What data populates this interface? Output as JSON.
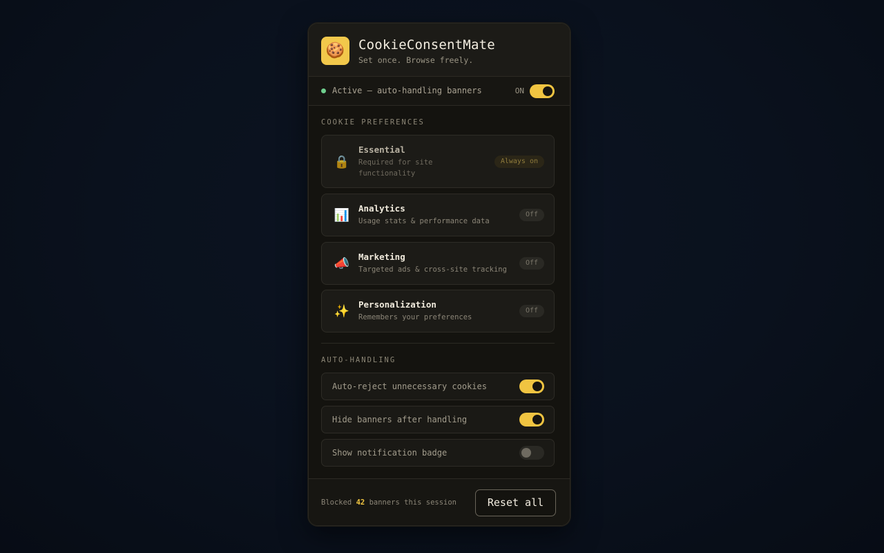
{
  "app": {
    "title": "CookieConsentMate",
    "tagline": "Set once. Browse freely.",
    "logo_icon": "cookie-icon",
    "logo_glyph": "🍪"
  },
  "status": {
    "text": "Active — auto-handling banners",
    "toggle_label": "ON",
    "enabled": true
  },
  "preferences": {
    "section_label": "COOKIE PREFERENCES",
    "items": [
      {
        "title": "Essential",
        "desc": "Required for site functionality",
        "icon": "lock-icon",
        "glyph": "🔒",
        "badge": "Always on"
      },
      {
        "title": "Analytics",
        "desc": "Usage stats & performance data",
        "icon": "bar-chart-icon",
        "glyph": "📊",
        "badge": "Off"
      },
      {
        "title": "Marketing",
        "desc": "Targeted ads & cross-site tracking",
        "icon": "megaphone-icon",
        "glyph": "📣",
        "badge": "Off"
      },
      {
        "title": "Personalization",
        "desc": "Remembers your preferences",
        "icon": "sparkles-icon",
        "glyph": "✨",
        "badge": "Off"
      }
    ]
  },
  "auto_handling": {
    "section_label": "AUTO-HANDLING",
    "options": [
      {
        "label": "Auto-reject unnecessary cookies",
        "enabled": true
      },
      {
        "label": "Hide banners after handling",
        "enabled": true
      },
      {
        "label": "Show notification badge",
        "enabled": false
      }
    ]
  },
  "footer": {
    "prefix": "Blocked",
    "count": "42",
    "suffix": "banners this session",
    "reset_label": "Reset all"
  },
  "colors": {
    "accent": "#f0c441",
    "status_green": "#6fcf8e",
    "background": "#0a111d",
    "panel": "#14130f"
  }
}
